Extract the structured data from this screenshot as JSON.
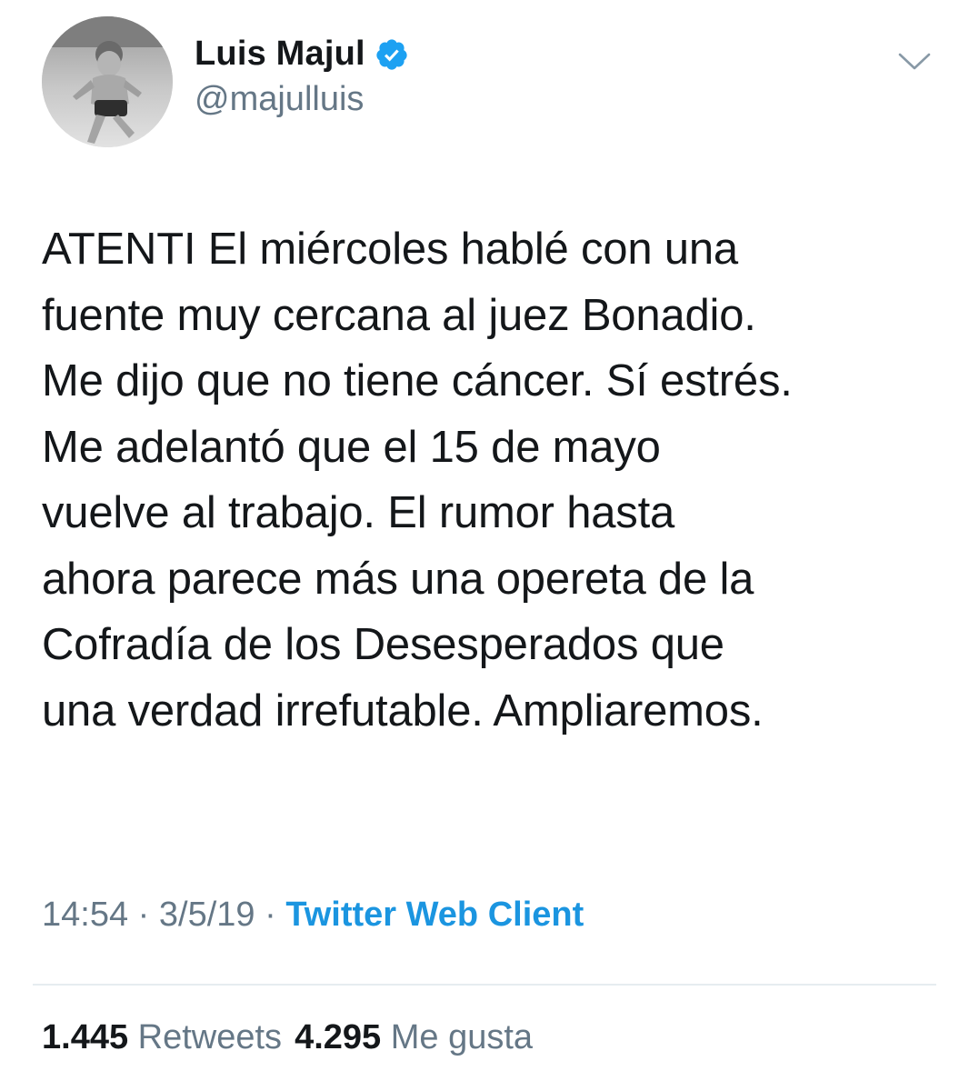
{
  "user": {
    "display_name": "Luis Majul",
    "handle": "@majulluis",
    "verified_icon": "verified-badge-icon",
    "avatar_icon": "profile-photo"
  },
  "tweet": {
    "lines": [
      "ATENTI El miércoles hablé con una",
      "fuente muy cercana al juez Bonadio.",
      "Me dijo que no tiene cáncer. Sí estrés.",
      "Me adelantó que el 15 de mayo",
      "vuelve al trabajo. El rumor hasta",
      "ahora parece más una opereta de la",
      "Cofradía de los Desesperados que",
      "una verdad irrefutable. Ampliaremos."
    ]
  },
  "meta": {
    "time": "14:54",
    "separator": " · ",
    "date": "3/5/19",
    "source": "Twitter Web Client"
  },
  "stats": {
    "retweets_count": "1.445",
    "retweets_label": "Retweets",
    "likes_count": "4.295",
    "likes_label": "Me gusta"
  },
  "colors": {
    "text": "#14171a",
    "secondary": "#657786",
    "link": "#1b95e0",
    "verified": "#1da1f2",
    "divider": "#e6ecf0"
  }
}
